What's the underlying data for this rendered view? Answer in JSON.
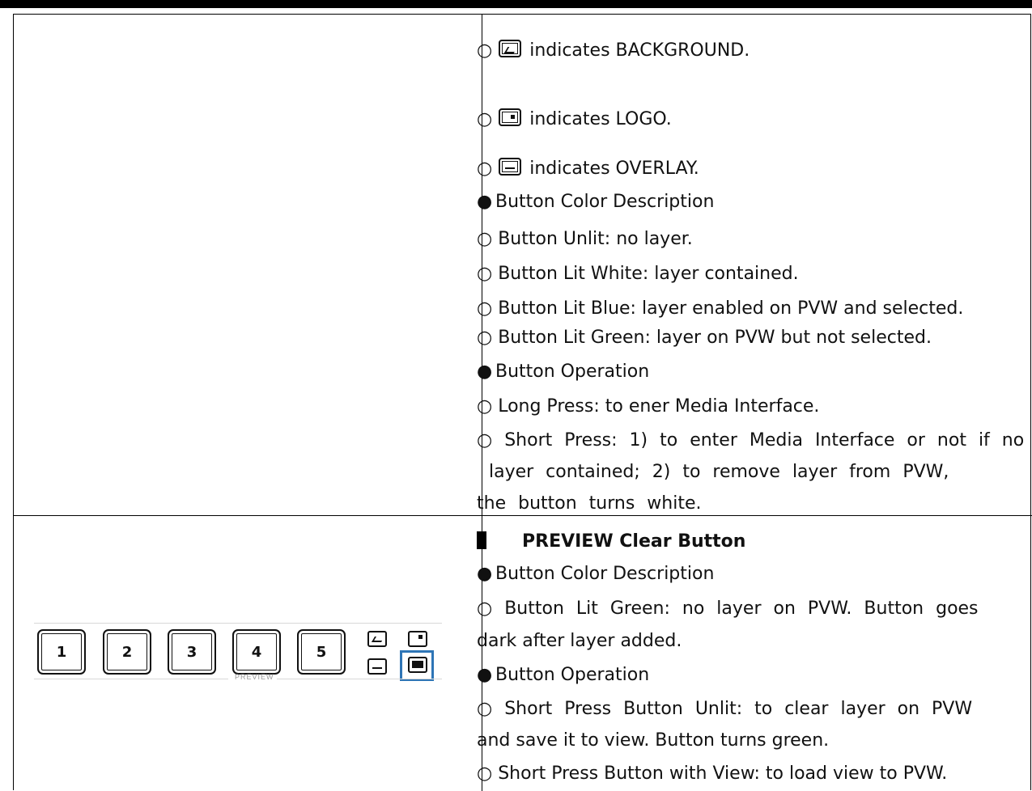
{
  "icons": {
    "background": "background-image-icon",
    "logo": "logo-icon",
    "overlay": "overlay-icon",
    "clear": "preview-clear-icon"
  },
  "top": {
    "bg_label": "indicates BACKGROUND.",
    "logo_label": "indicates LOGO.",
    "overlay_label": "indicates OVERLAY.",
    "color_title": "Button Color Description",
    "unlit": "Button Unlit: no layer.",
    "lit_white": "Button Lit White: layer contained.",
    "lit_blue": "Button Lit Blue: layer enabled on PVW and selected.",
    "lit_green": "Button Lit Green: layer on PVW but not selected.",
    "op_title": "Button Operation",
    "long_press": "Long Press: to ener Media Interface.",
    "short_press_1": "Short Press: 1) to enter Media Interface or not if no",
    "short_press_2": "layer contained; 2) to remove layer from PVW,",
    "short_press_3": "the button turns white."
  },
  "bottom": {
    "heading": "PREVIEW Clear Button",
    "color_title": "Button Color Description",
    "lit_green_1": "Button Lit Green: no layer on PVW. Button goes",
    "lit_green_2": "dark after layer added.",
    "op_title": "Button Operation",
    "unlit_1": "Short Press Button Unlit: to clear layer on PVW",
    "unlit_2": "and save it to view. Button turns green.",
    "with_view": "Short Press Button with View: to load view to PVW."
  },
  "panel": {
    "keys": [
      "1",
      "2",
      "3",
      "4",
      "5"
    ],
    "label": "PREVIEW",
    "highlight_color": "#2e75b6"
  }
}
